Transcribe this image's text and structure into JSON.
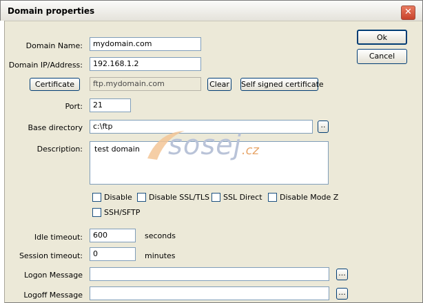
{
  "window": {
    "title": "Domain properties"
  },
  "form": {
    "domain_name": {
      "label": "Domain Name:",
      "value": "mydomain.com"
    },
    "domain_ip": {
      "label": "Domain IP/Address:",
      "value": "192.168.1.2"
    },
    "certificate": {
      "button": "Certificate",
      "value": "ftp.mydomain.com",
      "clear": "Clear",
      "self_signed": "Self signed certificate"
    },
    "port": {
      "label": "Port:",
      "value": "21"
    },
    "base_directory": {
      "label": "Base directory",
      "value": "c:\\ftp",
      "browse": ".."
    },
    "description": {
      "label": "Description:",
      "value": "test domain"
    },
    "checkboxes": [
      "Disable",
      "Disable SSL/TLS",
      "SSL Direct",
      "Disable Mode Z",
      "SSH/SFTP"
    ],
    "idle_timeout": {
      "label": "Idle timeout:",
      "value": "600",
      "unit": "seconds"
    },
    "session_timeout": {
      "label": "Session timeout:",
      "value": "0",
      "unit": "minutes"
    },
    "logon_message": {
      "label": "Logon Message",
      "value": "",
      "browse": "..."
    },
    "logoff_message": {
      "label": "Logoff Message",
      "value": "",
      "browse": "..."
    }
  },
  "actions": {
    "ok": "Ok",
    "cancel": "Cancel"
  },
  "watermark": {
    "text": "sosej",
    "suffix": ".cz"
  }
}
